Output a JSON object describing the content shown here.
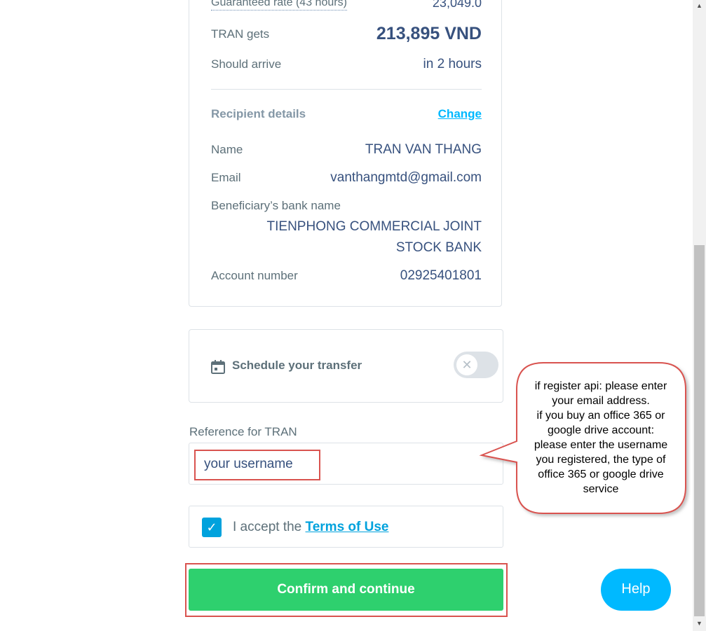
{
  "summary": {
    "rate_label": "Guaranteed rate (43 hours)",
    "rate_value": "23,049.0",
    "gets_label": "TRAN gets",
    "gets_value": "213,895 VND",
    "arrive_label": "Should arrive",
    "arrive_value": "in 2 hours"
  },
  "recipient": {
    "section_title": "Recipient details",
    "change_label": "Change",
    "name_label": "Name",
    "name_value": "TRAN VAN THANG",
    "email_label": "Email",
    "email_value": "vanthangmtd@gmail.com",
    "bank_label": "Beneficiary’s bank name",
    "bank_line1": "TIENPHONG COMMERCIAL JOINT",
    "bank_line2": "STOCK BANK",
    "account_label": "Account number",
    "account_value": "02925401801"
  },
  "schedule": {
    "label": "Schedule your transfer",
    "toggle_icon": "✕"
  },
  "reference": {
    "label": "Reference for TRAN",
    "value": "your username"
  },
  "terms": {
    "prefix": "I accept the",
    "link": "Terms of Use",
    "checked": true
  },
  "confirm_label": "Confirm and continue",
  "help_label": "Help",
  "callout": {
    "lines": [
      "if register api: please enter",
      "your email address.",
      "if you buy an office 365 or",
      "google drive account:",
      "please enter the username",
      "you registered, the type of",
      "office 365 or google drive",
      "service"
    ]
  },
  "colors": {
    "accent": "#00b9ff",
    "confirm": "#2ed06e",
    "highlight": "#d9534f"
  }
}
